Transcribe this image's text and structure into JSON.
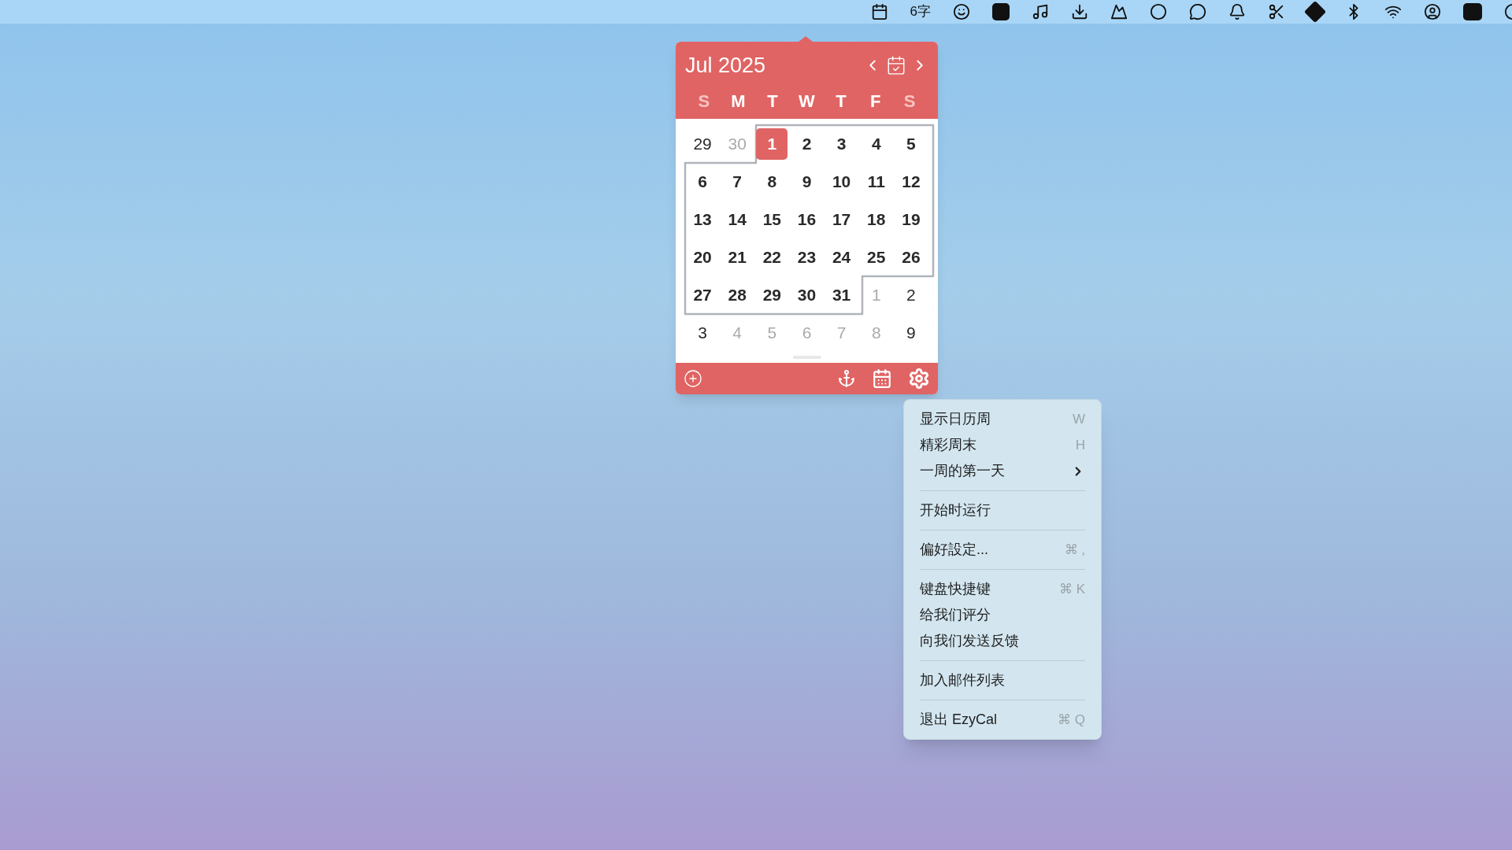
{
  "menu_bar": {
    "input_indicator": "6字"
  },
  "calendar": {
    "title": "Jul 2025",
    "weekdays": [
      {
        "label": "S",
        "weekend": true
      },
      {
        "label": "M",
        "weekend": false
      },
      {
        "label": "T",
        "weekend": false
      },
      {
        "label": "W",
        "weekend": false
      },
      {
        "label": "T",
        "weekend": false
      },
      {
        "label": "F",
        "weekend": false
      },
      {
        "label": "S",
        "weekend": true
      }
    ],
    "weeks": [
      [
        {
          "day": "29",
          "muted": false,
          "in_month": false,
          "selected": false
        },
        {
          "day": "30",
          "muted": true,
          "in_month": false,
          "selected": false
        },
        {
          "day": "1",
          "muted": false,
          "in_month": true,
          "selected": true
        },
        {
          "day": "2",
          "muted": false,
          "in_month": true,
          "selected": false
        },
        {
          "day": "3",
          "muted": false,
          "in_month": true,
          "selected": false
        },
        {
          "day": "4",
          "muted": false,
          "in_month": true,
          "selected": false
        },
        {
          "day": "5",
          "muted": false,
          "in_month": true,
          "selected": false
        }
      ],
      [
        {
          "day": "6",
          "muted": false,
          "in_month": true,
          "selected": false
        },
        {
          "day": "7",
          "muted": false,
          "in_month": true,
          "selected": false
        },
        {
          "day": "8",
          "muted": false,
          "in_month": true,
          "selected": false
        },
        {
          "day": "9",
          "muted": false,
          "in_month": true,
          "selected": false
        },
        {
          "day": "10",
          "muted": false,
          "in_month": true,
          "selected": false
        },
        {
          "day": "11",
          "muted": false,
          "in_month": true,
          "selected": false
        },
        {
          "day": "12",
          "muted": false,
          "in_month": true,
          "selected": false
        }
      ],
      [
        {
          "day": "13",
          "muted": false,
          "in_month": true,
          "selected": false
        },
        {
          "day": "14",
          "muted": false,
          "in_month": true,
          "selected": false
        },
        {
          "day": "15",
          "muted": false,
          "in_month": true,
          "selected": false
        },
        {
          "day": "16",
          "muted": false,
          "in_month": true,
          "selected": false
        },
        {
          "day": "17",
          "muted": false,
          "in_month": true,
          "selected": false
        },
        {
          "day": "18",
          "muted": false,
          "in_month": true,
          "selected": false
        },
        {
          "day": "19",
          "muted": false,
          "in_month": true,
          "selected": false
        }
      ],
      [
        {
          "day": "20",
          "muted": false,
          "in_month": true,
          "selected": false
        },
        {
          "day": "21",
          "muted": false,
          "in_month": true,
          "selected": false
        },
        {
          "day": "22",
          "muted": false,
          "in_month": true,
          "selected": false
        },
        {
          "day": "23",
          "muted": false,
          "in_month": true,
          "selected": false
        },
        {
          "day": "24",
          "muted": false,
          "in_month": true,
          "selected": false
        },
        {
          "day": "25",
          "muted": false,
          "in_month": true,
          "selected": false
        },
        {
          "day": "26",
          "muted": false,
          "in_month": true,
          "selected": false
        }
      ],
      [
        {
          "day": "27",
          "muted": false,
          "in_month": true,
          "selected": false
        },
        {
          "day": "28",
          "muted": false,
          "in_month": true,
          "selected": false
        },
        {
          "day": "29",
          "muted": false,
          "in_month": true,
          "selected": false
        },
        {
          "day": "30",
          "muted": false,
          "in_month": true,
          "selected": false
        },
        {
          "day": "31",
          "muted": false,
          "in_month": true,
          "selected": false
        },
        {
          "day": "1",
          "muted": true,
          "in_month": false,
          "selected": false
        },
        {
          "day": "2",
          "muted": false,
          "in_month": false,
          "selected": false
        }
      ],
      [
        {
          "day": "3",
          "muted": false,
          "in_month": false,
          "selected": false
        },
        {
          "day": "4",
          "muted": true,
          "in_month": false,
          "selected": false
        },
        {
          "day": "5",
          "muted": true,
          "in_month": false,
          "selected": false
        },
        {
          "day": "6",
          "muted": true,
          "in_month": false,
          "selected": false
        },
        {
          "day": "7",
          "muted": true,
          "in_month": false,
          "selected": false
        },
        {
          "day": "8",
          "muted": true,
          "in_month": false,
          "selected": false
        },
        {
          "day": "9",
          "muted": false,
          "in_month": false,
          "selected": false
        }
      ]
    ]
  },
  "context_menu": {
    "groups": [
      [
        {
          "label": "显示日历周",
          "shortcut": "W",
          "kind": "item"
        },
        {
          "label": "精彩周末",
          "shortcut": "H",
          "kind": "item"
        },
        {
          "label": "一周的第一天",
          "kind": "submenu"
        }
      ],
      [
        {
          "label": "开始时运行",
          "kind": "item"
        }
      ],
      [
        {
          "label": "偏好設定...",
          "shortcut": "⌘ ,",
          "kind": "item"
        }
      ],
      [
        {
          "label": "键盘快捷键",
          "shortcut": "⌘ K",
          "kind": "item"
        },
        {
          "label": "给我们评分",
          "kind": "item"
        },
        {
          "label": "向我们发送反馈",
          "kind": "item"
        }
      ],
      [
        {
          "label": "加入邮件列表",
          "kind": "item"
        }
      ],
      [
        {
          "label": "退出 EzyCal",
          "shortcut": "⌘ Q",
          "kind": "item"
        }
      ]
    ]
  }
}
